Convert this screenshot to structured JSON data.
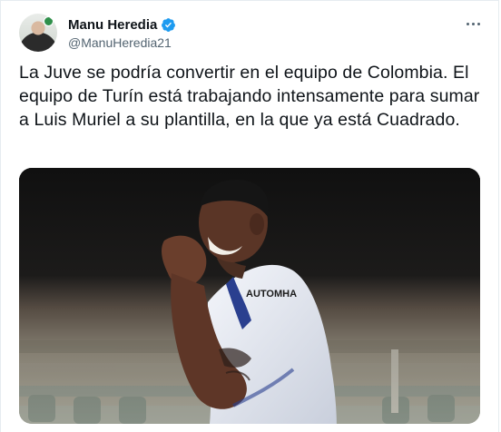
{
  "tweet": {
    "author": {
      "name": "Manu Heredia",
      "handle": "@ManuHeredia21",
      "verified": true
    },
    "text": "La Juve se podría convertir en el equipo de Colombia. El equipo de Turín está trabajando intensamente para sumar a Luis Muriel a su plantilla, en la que ya está Cuadrado.",
    "media": {
      "jersey_sponsor": "AUTOMHA"
    }
  },
  "icons": {
    "verified": "verified-badge-icon",
    "more": "more-options-icon"
  },
  "colors": {
    "verified_blue": "#1d9bf0",
    "text": "#0f1419",
    "secondary_text": "#536471"
  }
}
